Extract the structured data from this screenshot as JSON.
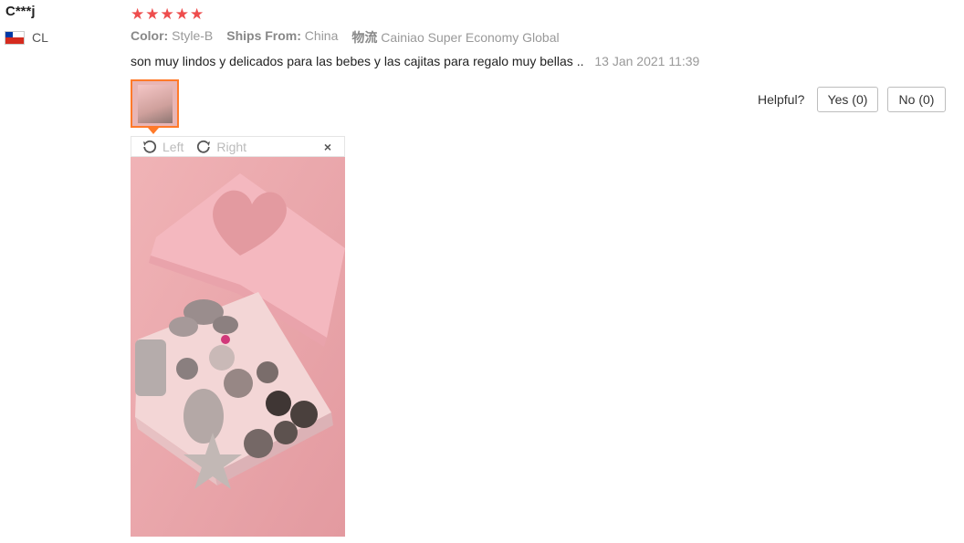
{
  "review": {
    "user_name": "C***j",
    "country_code": "CL",
    "stars": "★★★★★",
    "color_label": "Color:",
    "color_value": "Style-B",
    "ships_label": "Ships From:",
    "ships_value": "China",
    "logistics_icon_text": "物流",
    "logistics_value": "Cainiao Super Economy Global",
    "comment": "son muy lindos y delicados para las bebes y las cajitas para regalo muy bellas ..",
    "date": "13 Jan 2021 11:39"
  },
  "viewer": {
    "rotate_left_label": "Left",
    "rotate_right_label": "Right",
    "close_label": "×"
  },
  "helpful": {
    "label": "Helpful?",
    "yes_label": "Yes (0)",
    "no_label": "No (0)"
  },
  "colors": {
    "star": "#ee4d4d",
    "thumb_border": "#ff7a2a",
    "photo_bg": "#eaa6ab"
  },
  "icons": [
    "chile-flag-icon",
    "rotate-left-icon",
    "rotate-right-icon",
    "close-icon"
  ]
}
